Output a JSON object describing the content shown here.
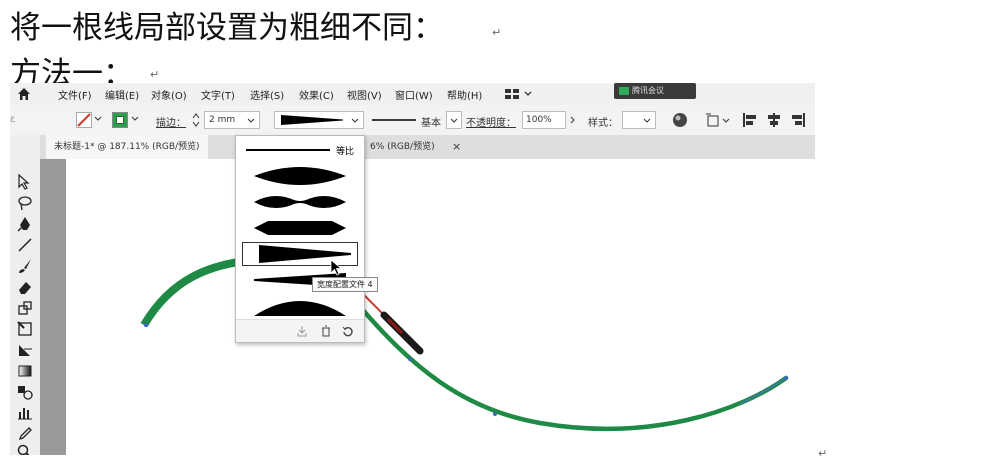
{
  "document": {
    "heading": "将一根线局部设置为粗细不同：",
    "subheading": "方法一：",
    "return_mark": "↵"
  },
  "app": {
    "menu": [
      "文件(F)",
      "编辑(E)",
      "对象(O)",
      "文字(T)",
      "选择(S)",
      "效果(C)",
      "视图(V)",
      "窗口(W)",
      "帮助(H)"
    ],
    "meeting_badge": "腾讯会议",
    "control": {
      "stroke_label": "描边：",
      "stroke_value": "2 mm",
      "brush_label": "基本",
      "opacity_label": "不透明度：",
      "opacity_value": "100%",
      "style_label": "样式："
    },
    "tabs": {
      "active": "未标题-1* @ 187.11% (RGB/预览)",
      "inactive": "6% (RGB/预览)",
      "close": "×"
    },
    "width_profiles": {
      "items": [
        {
          "label": "等比",
          "shape": "uniform"
        },
        {
          "label": "",
          "shape": "lens"
        },
        {
          "label": "",
          "shape": "pinched"
        },
        {
          "label": "",
          "shape": "hexagon"
        },
        {
          "label": "",
          "shape": "taper-right",
          "selected": true
        },
        {
          "label": "",
          "shape": "taper-left"
        },
        {
          "label": "",
          "shape": "half-dome"
        }
      ],
      "tooltip": "宽度配置文件 4"
    },
    "colors": {
      "path_green": "#1e8a45",
      "stroke_red": "#d0352a",
      "fill_green": "#2aa14a"
    }
  }
}
